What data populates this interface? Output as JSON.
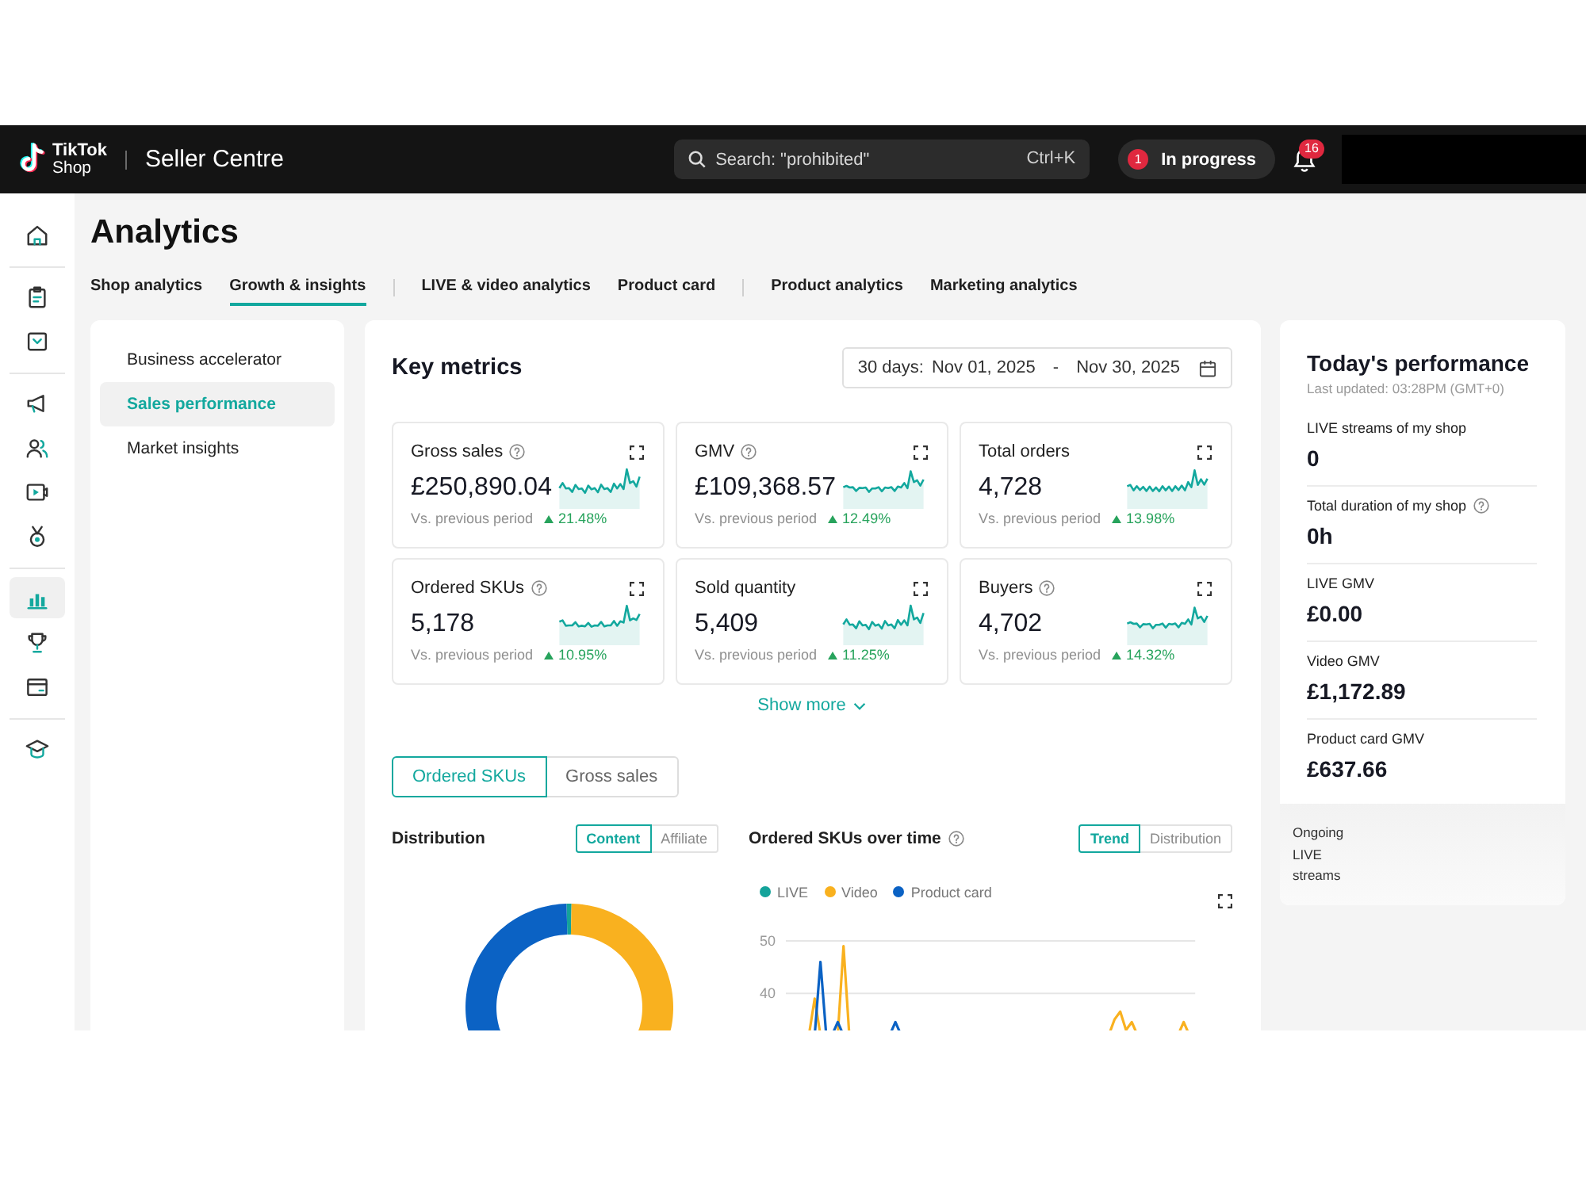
{
  "header": {
    "logo": {
      "line_1": "TikTok",
      "line_2": "Shop"
    },
    "title": "Seller Centre",
    "search": {
      "placeholder": "Search: \"prohibited\"",
      "shortcut": "Ctrl+K"
    },
    "task_status": {
      "count": "1",
      "label": "In progress"
    },
    "notifications": {
      "count": "16"
    }
  },
  "nav_rail": {
    "groups": [
      [
        {
          "selected": false
        }
      ],
      [
        {
          "selected": false
        },
        {
          "selected": false
        }
      ],
      [
        {
          "selected": false
        },
        {
          "selected": false
        },
        {
          "selected": false
        },
        {
          "selected": false
        }
      ],
      [
        {
          "selected": true
        },
        {
          "selected": false
        },
        {
          "selected": false
        }
      ],
      [
        {
          "selected": false
        }
      ]
    ]
  },
  "page": {
    "title": "Analytics",
    "tab_groups": [
      [
        {
          "label": "Shop analytics",
          "selected": false
        },
        {
          "label": "Growth & insights",
          "selected": true
        }
      ],
      [
        {
          "label": "LIVE & video analytics",
          "selected": false
        },
        {
          "label": "Product card",
          "selected": false
        }
      ],
      [
        {
          "label": "Product analytics",
          "selected": false
        },
        {
          "label": "Marketing analytics",
          "selected": false
        }
      ]
    ]
  },
  "sub_nav": {
    "items": [
      {
        "label": "Business accelerator",
        "selected": false
      },
      {
        "label": "Sales performance",
        "selected": true
      },
      {
        "label": "Market insights",
        "selected": false
      }
    ]
  },
  "key_metrics": {
    "title": "Key metrics",
    "date_range": {
      "preset": "30 days:",
      "start": "Nov 01, 2025",
      "separator": "-",
      "end": "Nov 30, 2025"
    },
    "metrics": [
      {
        "label": "Gross sales",
        "help": true,
        "value": "£250,890.04",
        "comparison": "Vs. previous period",
        "change": "21.48%",
        "rising": true
      },
      {
        "label": "GMV",
        "help": true,
        "value": "£109,368.57",
        "comparison": "Vs. previous period",
        "change": "12.49%",
        "rising": true
      },
      {
        "label": "Total orders",
        "help": false,
        "value": "4,728",
        "comparison": "Vs. previous period",
        "change": "13.98%",
        "rising": true
      },
      {
        "label": "Ordered SKUs",
        "help": true,
        "value": "5,178",
        "comparison": "Vs. previous period",
        "change": "10.95%",
        "rising": true
      },
      {
        "label": "Sold quantity",
        "help": false,
        "value": "5,409",
        "comparison": "Vs. previous period",
        "change": "11.25%",
        "rising": true
      },
      {
        "label": "Buyers",
        "help": true,
        "value": "4,702",
        "comparison": "Vs. previous period",
        "change": "14.32%",
        "rising": true
      }
    ],
    "show_more": "Show more"
  },
  "breakdown": {
    "metric_tabs": [
      {
        "label": "Ordered SKUs",
        "selected": true
      },
      {
        "label": "Gross sales",
        "selected": false
      }
    ],
    "distribution": {
      "title": "Distribution",
      "toggle": [
        {
          "label": "Content",
          "selected": true
        },
        {
          "label": "Affiliate",
          "selected": false
        }
      ]
    },
    "trend": {
      "title": "Ordered SKUs over time",
      "help": true,
      "toggle": [
        {
          "label": "Trend",
          "selected": true
        },
        {
          "label": "Distribution",
          "selected": false
        }
      ],
      "legend": [
        {
          "label": "LIVE",
          "color": "#14a39a"
        },
        {
          "label": "Video",
          "color": "#f9b11f"
        },
        {
          "label": "Product card",
          "color": "#0b62c4"
        }
      ],
      "y_axis_labels": [
        "50",
        "40"
      ]
    }
  },
  "todays_performance": {
    "title": "Today's performance",
    "last_updated": "Last updated: 03:28PM (GMT+0)",
    "stats": [
      {
        "label": "LIVE streams of my shop",
        "help": false,
        "value": "0"
      },
      {
        "label": "Total duration of my shop",
        "help": true,
        "value": "0h"
      },
      {
        "label": "LIVE GMV",
        "help": false,
        "value": "£0.00"
      },
      {
        "label": "Video GMV",
        "help": false,
        "value": "£1,172.89"
      },
      {
        "label": "Product card GMV",
        "help": false,
        "value": "£637.66"
      }
    ],
    "footer": "Ongoing LIVE streams"
  }
}
